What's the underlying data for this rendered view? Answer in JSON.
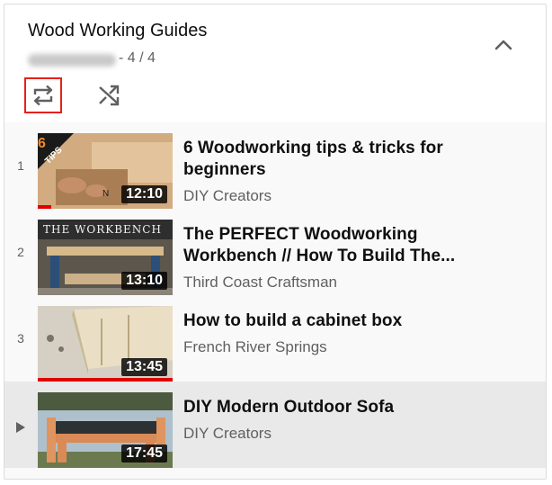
{
  "playlist": {
    "title": "Wood Working Guides",
    "position": "- 4 / 4"
  },
  "icons": {
    "collapse": "chevron-up-icon",
    "loop": "loop-icon",
    "shuffle": "shuffle-icon",
    "now_playing": "play-indicator-icon"
  },
  "colors": {
    "accent_red": "#e62117",
    "progress_red": "#e00000",
    "active_row": "#e9e9e9"
  },
  "videos": [
    {
      "index": "1",
      "title": "6 Woodworking tips & tricks for beginners",
      "channel": "DIY Creators",
      "duration": "12:10",
      "thumb_text_num": "6",
      "thumb_text_tag": "TIPS",
      "progress": 0.1
    },
    {
      "index": "2",
      "title": "The PERFECT Woodworking Workbench // How To Build The...",
      "channel": "Third Coast Craftsman",
      "duration": "13:10",
      "thumb_text": "THE WORKBENCH"
    },
    {
      "index": "3",
      "title": "How to build a cabinet box",
      "channel": "French River Springs",
      "duration": "13:45",
      "progress": 1.0
    },
    {
      "index": "",
      "title": "DIY Modern Outdoor Sofa",
      "channel": "DIY Creators",
      "duration": "17:45",
      "active": true
    }
  ]
}
